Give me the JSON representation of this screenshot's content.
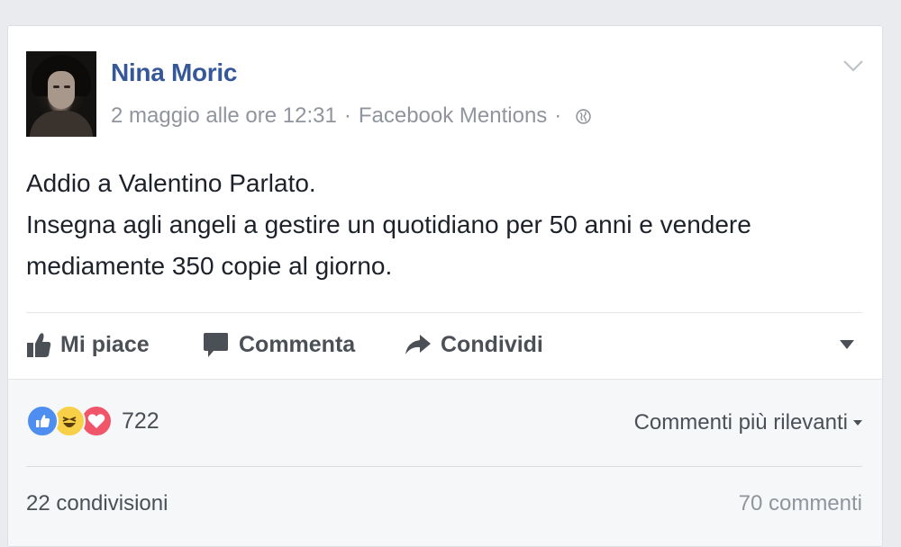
{
  "post": {
    "author": "Nina Moric",
    "timestamp": "2 maggio alle ore 12:31",
    "separator": "·",
    "source": "Facebook Mentions",
    "privacy_icon": "globe-icon",
    "text_lines": [
      "Addio a Valentino Parlato.",
      "Insegna agli angeli a gestire un quotidiano per 50 anni e vendere",
      "mediamente 350 copie al giorno."
    ]
  },
  "actions": {
    "like_label": "Mi piace",
    "comment_label": "Commenta",
    "share_label": "Condividi"
  },
  "footer": {
    "reaction_icons": [
      "like-reaction-icon",
      "haha-reaction-icon",
      "love-reaction-icon"
    ],
    "reaction_count": "722",
    "sort_label": "Commenti più rilevanti",
    "shares_label": "22 condivisioni",
    "comments_label": "70 commenti"
  },
  "colors": {
    "author_link": "#365899",
    "meta_gray": "#90949c",
    "text": "#1d2129",
    "action_gray": "#4b4f56",
    "like_blue": "#4d8ef0",
    "haha_yellow": "#f7d047",
    "love_red": "#f0556a",
    "page_bg": "#e9ebee",
    "footer_bg": "#f6f7f9"
  }
}
